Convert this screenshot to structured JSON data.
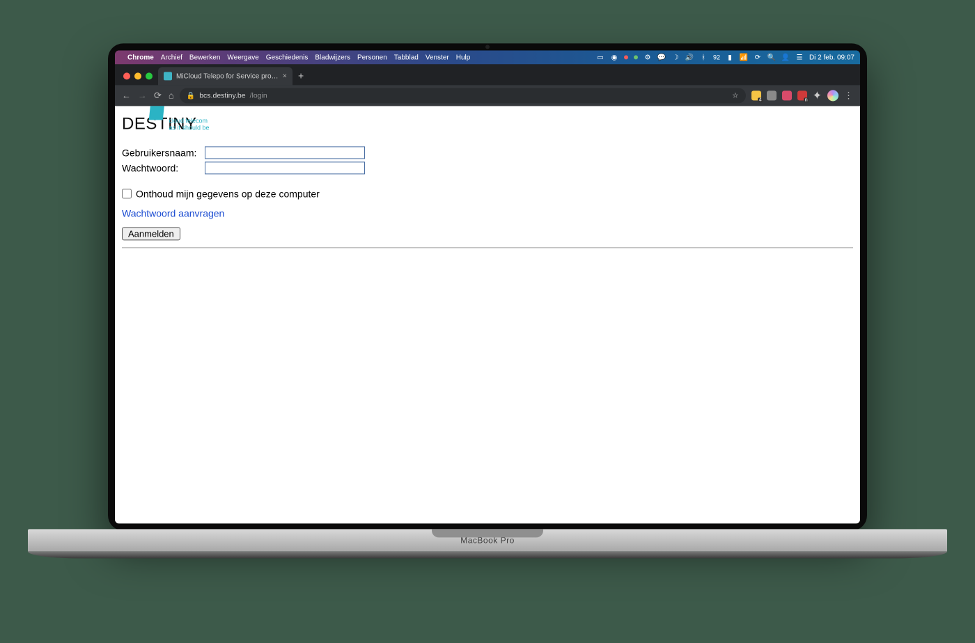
{
  "menubar": {
    "app": "Chrome",
    "menus": [
      "Archief",
      "Bewerken",
      "Weergave",
      "Geschiedenis",
      "Bladwijzers",
      "Personen",
      "Tabblad",
      "Venster",
      "Hulp"
    ],
    "clock": "Di 2 feb.  09:07",
    "battery": "92"
  },
  "chrome": {
    "tab_title": "MiCloud Telepo for Service pro…",
    "url_host": "bcs.destiny.be",
    "url_path": "/login",
    "ext_badge_a": "4",
    "ext_badge_b": "n"
  },
  "logo": {
    "word": "DESTINY",
    "tag_line1": "cloud telecom",
    "tag_line2": "as it should be"
  },
  "form": {
    "username_label": "Gebruikersnaam:",
    "password_label": "Wachtwoord:",
    "remember_label": "Onthoud mijn gegevens op deze computer",
    "request_pw_label": "Wachtwoord aanvragen",
    "submit_label": "Aanmelden",
    "username_value": "",
    "password_value": ""
  },
  "deck": {
    "brand": "MacBook Pro"
  }
}
